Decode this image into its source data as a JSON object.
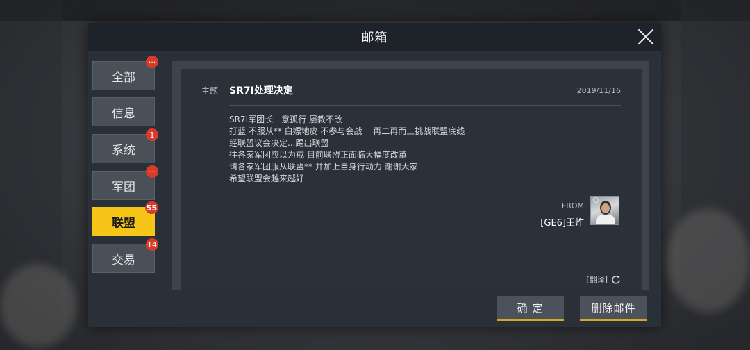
{
  "window": {
    "title": "邮箱"
  },
  "tabs": [
    {
      "label": "全部",
      "badge": "···"
    },
    {
      "label": "信息",
      "badge": ""
    },
    {
      "label": "系统",
      "badge": "1"
    },
    {
      "label": "军团",
      "badge": "···"
    },
    {
      "label": "联盟",
      "badge": "55",
      "active": true
    },
    {
      "label": "交易",
      "badge": "14"
    }
  ],
  "mail": {
    "subject_label": "主题",
    "subject": "SR7I处理决定",
    "date": "2019/11/16",
    "body": [
      "SR7I军团长一意孤行 屡教不改",
      "打蓝 不服从** 白嫖地皮 不参与会战 一再二再而三挑战联盟底线",
      "经联盟议会决定...踢出联盟",
      "往各家军团应以为戒 目前联盟正面临大幅度改革",
      "请各家军团服从联盟** 并加上自身行动力 谢谢大家",
      "希望联盟会越来越好"
    ],
    "from_label": "FROM",
    "sender": "[GE6]王炸",
    "avatar_tag": "☺",
    "translate_label": "[翻译]"
  },
  "buttons": {
    "confirm": "确 定",
    "delete": "删除邮件"
  },
  "colors": {
    "accent": "#f5c518",
    "badge": "#d93b2b",
    "panel": "#2a3038"
  },
  "icons": {
    "close": "close-icon",
    "refresh": "refresh-icon"
  }
}
